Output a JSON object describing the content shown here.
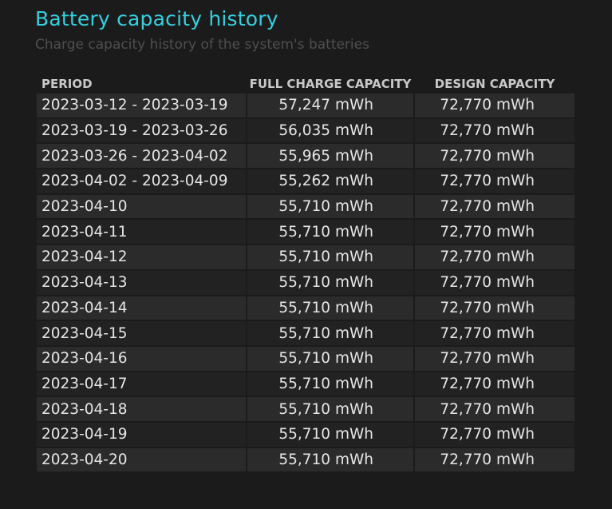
{
  "header": {
    "title": "Battery capacity history",
    "subtitle": "Charge capacity history of the system's batteries"
  },
  "table": {
    "columns": [
      "PERIOD",
      "FULL CHARGE CAPACITY",
      "DESIGN CAPACITY"
    ],
    "rows": [
      {
        "period": "2023-03-12 - 2023-03-19",
        "full_charge_capacity": "57,247 mWh",
        "design_capacity": "72,770 mWh"
      },
      {
        "period": "2023-03-19 - 2023-03-26",
        "full_charge_capacity": "56,035 mWh",
        "design_capacity": "72,770 mWh"
      },
      {
        "period": "2023-03-26 - 2023-04-02",
        "full_charge_capacity": "55,965 mWh",
        "design_capacity": "72,770 mWh"
      },
      {
        "period": "2023-04-02 - 2023-04-09",
        "full_charge_capacity": "55,262 mWh",
        "design_capacity": "72,770 mWh"
      },
      {
        "period": "2023-04-10",
        "full_charge_capacity": "55,710 mWh",
        "design_capacity": "72,770 mWh"
      },
      {
        "period": "2023-04-11",
        "full_charge_capacity": "55,710 mWh",
        "design_capacity": "72,770 mWh"
      },
      {
        "period": "2023-04-12",
        "full_charge_capacity": "55,710 mWh",
        "design_capacity": "72,770 mWh"
      },
      {
        "period": "2023-04-13",
        "full_charge_capacity": "55,710 mWh",
        "design_capacity": "72,770 mWh"
      },
      {
        "period": "2023-04-14",
        "full_charge_capacity": "55,710 mWh",
        "design_capacity": "72,770 mWh"
      },
      {
        "period": "2023-04-15",
        "full_charge_capacity": "55,710 mWh",
        "design_capacity": "72,770 mWh"
      },
      {
        "period": "2023-04-16",
        "full_charge_capacity": "55,710 mWh",
        "design_capacity": "72,770 mWh"
      },
      {
        "period": "2023-04-17",
        "full_charge_capacity": "55,710 mWh",
        "design_capacity": "72,770 mWh"
      },
      {
        "period": "2023-04-18",
        "full_charge_capacity": "55,710 mWh",
        "design_capacity": "72,770 mWh"
      },
      {
        "period": "2023-04-19",
        "full_charge_capacity": "55,710 mWh",
        "design_capacity": "72,770 mWh"
      },
      {
        "period": "2023-04-20",
        "full_charge_capacity": "55,710 mWh",
        "design_capacity": "72,770 mWh"
      }
    ]
  },
  "colors": {
    "background": "#1b1b1b",
    "title": "#35cfe0",
    "subtitle": "#4f4f4f",
    "header_text": "#c8c8c8",
    "cell_text": "#e6e6e6",
    "row_odd": "#2b2b2b",
    "row_even": "#222222"
  }
}
